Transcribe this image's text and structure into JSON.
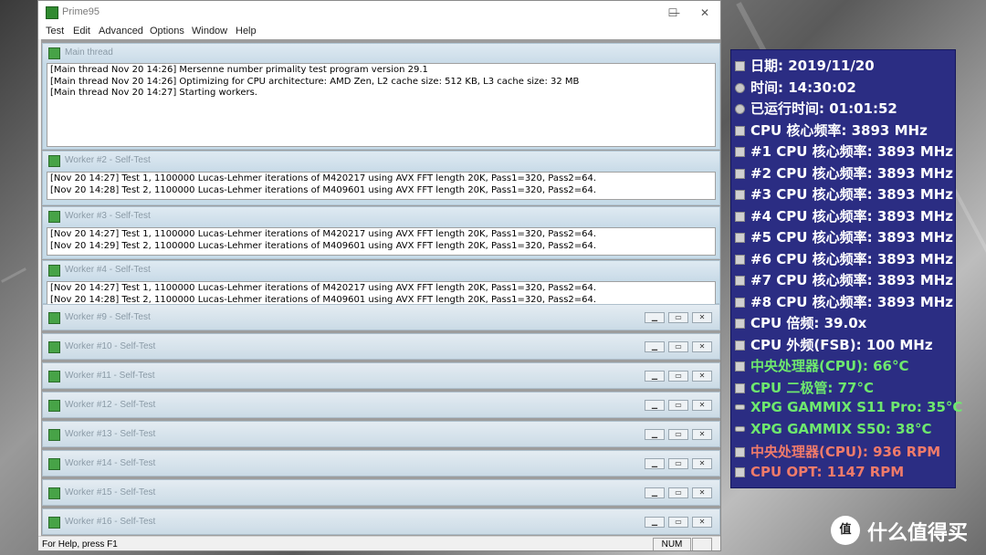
{
  "window": {
    "title": "Prime95",
    "minimize": "—",
    "maximize": "☐",
    "close": "✕"
  },
  "menu": [
    "Test",
    "Edit",
    "Advanced",
    "Options",
    "Window",
    "Help"
  ],
  "main_thread": {
    "title": "Main thread",
    "lines": [
      "[Main thread Nov 20 14:26] Mersenne number primality test program version 29.1",
      "[Main thread Nov 20 14:26] Optimizing for CPU architecture: AMD Zen, L2 cache size: 512 KB, L3 cache size: 32 MB",
      "[Main thread Nov 20 14:27] Starting workers."
    ]
  },
  "workers_open": [
    {
      "title": "Worker #2 - Self-Test",
      "lines": [
        "[Nov 20 14:27] Test 1, 1100000 Lucas-Lehmer iterations of M420217 using AVX FFT length 20K, Pass1=320, Pass2=64.",
        "[Nov 20 14:28] Test 2, 1100000 Lucas-Lehmer iterations of M409601 using AVX FFT length 20K, Pass1=320, Pass2=64."
      ]
    },
    {
      "title": "Worker #3 - Self-Test",
      "lines": [
        "[Nov 20 14:27] Test 1, 1100000 Lucas-Lehmer iterations of M420217 using AVX FFT length 20K, Pass1=320, Pass2=64.",
        "[Nov 20 14:29] Test 2, 1100000 Lucas-Lehmer iterations of M409601 using AVX FFT length 20K, Pass1=320, Pass2=64."
      ]
    },
    {
      "title": "Worker #4 - Self-Test",
      "lines": [
        "[Nov 20 14:27] Test 1, 1100000 Lucas-Lehmer iterations of M420217 using AVX FFT length 20K, Pass1=320, Pass2=64.",
        "[Nov 20 14:28] Test 2, 1100000 Lucas-Lehmer iterations of M409601 using AVX FFT length 20K, Pass1=320, Pass2=64."
      ]
    }
  ],
  "workers_min": [
    "Worker #9 - Self-Test",
    "Worker #10 - Self-Test",
    "Worker #11 - Self-Test",
    "Worker #12 - Self-Test",
    "Worker #13 - Self-Test",
    "Worker #14 - Self-Test",
    "Worker #15 - Self-Test",
    "Worker #16 - Self-Test"
  ],
  "status": {
    "help": "For Help, press F1",
    "num": "NUM"
  },
  "osd": {
    "items": [
      {
        "text": "日期: 2019/11/20",
        "color": "#ffffff",
        "icon": "calendar"
      },
      {
        "text": "时间: 14:30:02",
        "color": "#ffffff",
        "icon": "clock"
      },
      {
        "text": "已运行时间: 01:01:52",
        "color": "#ffffff",
        "icon": "clock"
      },
      {
        "text": "CPU 核心频率: 3893 MHz",
        "color": "#ffffff",
        "icon": "chip"
      },
      {
        "text": "#1 CPU 核心频率: 3893 MHz",
        "color": "#ffffff",
        "icon": "chip"
      },
      {
        "text": "#2 CPU 核心频率: 3893 MHz",
        "color": "#ffffff",
        "icon": "chip"
      },
      {
        "text": "#3 CPU 核心频率: 3893 MHz",
        "color": "#ffffff",
        "icon": "chip"
      },
      {
        "text": "#4 CPU 核心频率: 3893 MHz",
        "color": "#ffffff",
        "icon": "chip"
      },
      {
        "text": "#5 CPU 核心频率: 3893 MHz",
        "color": "#ffffff",
        "icon": "chip"
      },
      {
        "text": "#6 CPU 核心频率: 3893 MHz",
        "color": "#ffffff",
        "icon": "chip"
      },
      {
        "text": "#7 CPU 核心频率: 3893 MHz",
        "color": "#ffffff",
        "icon": "chip"
      },
      {
        "text": "#8 CPU 核心频率: 3893 MHz",
        "color": "#ffffff",
        "icon": "chip"
      },
      {
        "text": "CPU 倍频: 39.0x",
        "color": "#ffffff",
        "icon": "chip"
      },
      {
        "text": "CPU 外频(FSB): 100 MHz",
        "color": "#ffffff",
        "icon": "chip"
      },
      {
        "text": "中央处理器(CPU): 66°C",
        "color": "#6ee86e",
        "icon": "chip"
      },
      {
        "text": "CPU 二极管: 77°C",
        "color": "#6ee86e",
        "icon": "chip"
      },
      {
        "text": "XPG GAMMIX S11 Pro: 35°C",
        "color": "#6ee86e",
        "icon": "drive"
      },
      {
        "text": "XPG GAMMIX S50: 38°C",
        "color": "#6ee86e",
        "icon": "drive"
      },
      {
        "text": "中央处理器(CPU): 936 RPM",
        "color": "#f07b6a",
        "icon": "chip"
      },
      {
        "text": "CPU OPT: 1147 RPM",
        "color": "#f07b6a",
        "icon": "chip"
      }
    ]
  },
  "watermark": {
    "logo": "值",
    "text": "什么值得买"
  }
}
